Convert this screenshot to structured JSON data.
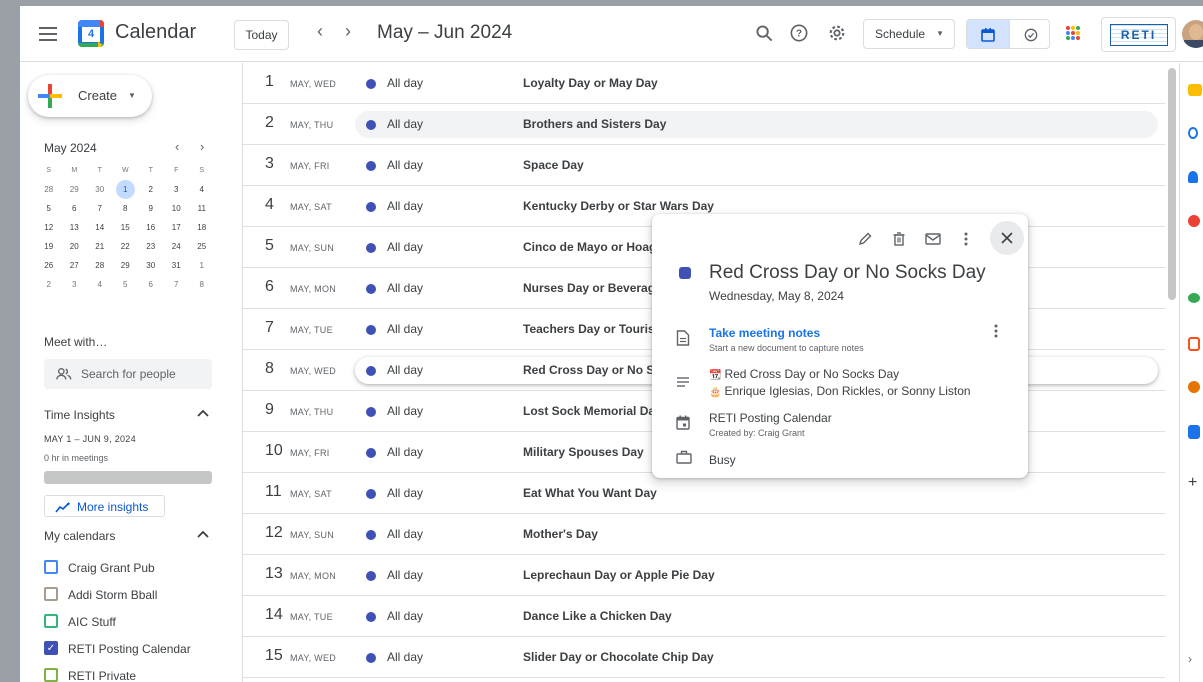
{
  "header": {
    "app_title": "Calendar",
    "logo_day": "4",
    "today_label": "Today",
    "prev": "‹",
    "next": "›",
    "date_range": "May – Jun 2024",
    "view_select": "Schedule",
    "brand_badge": "RETI"
  },
  "sidebar": {
    "create_label": "Create",
    "mini_cal": {
      "title": "May 2024",
      "weekdays": [
        "S",
        "M",
        "T",
        "W",
        "T",
        "F",
        "S"
      ],
      "weeks": [
        [
          "28",
          "29",
          "30",
          "1",
          "2",
          "3",
          "4"
        ],
        [
          "5",
          "6",
          "7",
          "8",
          "9",
          "10",
          "11"
        ],
        [
          "12",
          "13",
          "14",
          "15",
          "16",
          "17",
          "18"
        ],
        [
          "19",
          "20",
          "21",
          "22",
          "23",
          "24",
          "25"
        ],
        [
          "26",
          "27",
          "28",
          "29",
          "30",
          "31",
          "1"
        ],
        [
          "2",
          "3",
          "4",
          "5",
          "6",
          "7",
          "8"
        ]
      ]
    },
    "meet_title": "Meet with…",
    "search_people_placeholder": "Search for people",
    "time_insights": {
      "title": "Time Insights",
      "range": "MAY 1 – JUN 9, 2024",
      "hours": "0 hr in meetings",
      "more_label": "More insights"
    },
    "my_calendars": {
      "title": "My calendars",
      "items": [
        {
          "label": "Craig Grant Pub",
          "color": "#4285f4",
          "checked": false
        },
        {
          "label": "Addi Storm Bball",
          "color": "#a79b8e",
          "checked": false
        },
        {
          "label": "AIC Stuff",
          "color": "#33b679",
          "checked": false
        },
        {
          "label": "RETI Posting Calendar",
          "color": "#3f51b5",
          "checked": true
        },
        {
          "label": "RETI Private",
          "color": "#7cb342",
          "checked": false
        }
      ]
    }
  },
  "schedule": {
    "rows": [
      {
        "day": "1",
        "sub": "MAY, WED",
        "time": "All day",
        "title": "Loyalty Day or May Day"
      },
      {
        "day": "2",
        "sub": "MAY, THU",
        "time": "All day",
        "title": "Brothers and Sisters Day"
      },
      {
        "day": "3",
        "sub": "MAY, FRI",
        "time": "All day",
        "title": "Space Day"
      },
      {
        "day": "4",
        "sub": "MAY, SAT",
        "time": "All day",
        "title": "Kentucky Derby or Star Wars Day"
      },
      {
        "day": "5",
        "sub": "MAY, SUN",
        "time": "All day",
        "title": "Cinco de Mayo or Hoagie"
      },
      {
        "day": "6",
        "sub": "MAY, MON",
        "time": "All day",
        "title": "Nurses Day or Beverage"
      },
      {
        "day": "7",
        "sub": "MAY, TUE",
        "time": "All day",
        "title": "Teachers Day or Tourism"
      },
      {
        "day": "8",
        "sub": "MAY, WED",
        "time": "All day",
        "title": "Red Cross Day or No Soc"
      },
      {
        "day": "9",
        "sub": "MAY, THU",
        "time": "All day",
        "title": "Lost Sock Memorial Day"
      },
      {
        "day": "10",
        "sub": "MAY, FRI",
        "time": "All day",
        "title": "Military Spouses Day"
      },
      {
        "day": "11",
        "sub": "MAY, SAT",
        "time": "All day",
        "title": "Eat What You Want Day"
      },
      {
        "day": "12",
        "sub": "MAY, SUN",
        "time": "All day",
        "title": "Mother's Day"
      },
      {
        "day": "13",
        "sub": "MAY, MON",
        "time": "All day",
        "title": "Leprechaun Day or Apple Pie Day"
      },
      {
        "day": "14",
        "sub": "MAY, TUE",
        "time": "All day",
        "title": "Dance Like a Chicken Day"
      },
      {
        "day": "15",
        "sub": "MAY, WED",
        "time": "All day",
        "title": "Slider Day or Chocolate Chip Day"
      }
    ]
  },
  "popup": {
    "title": "Red Cross Day or No Socks Day",
    "date": "Wednesday, May 8, 2024",
    "notes_title": "Take meeting notes",
    "notes_sub": "Start a new document to capture notes",
    "desc_line1": "Red Cross Day or No Socks Day",
    "desc_line2": "Enrique Iglesias, Don Rickles, or Sonny Liston",
    "calendar_name": "RETI Posting Calendar",
    "created_by": "Created by: Craig Grant",
    "availability": "Busy",
    "event_color": "#3f51b5"
  },
  "colors": {
    "accent": "#1a73e8",
    "event_dot": "#3f51b5",
    "selected_day_bg": "#c2dbfd"
  }
}
